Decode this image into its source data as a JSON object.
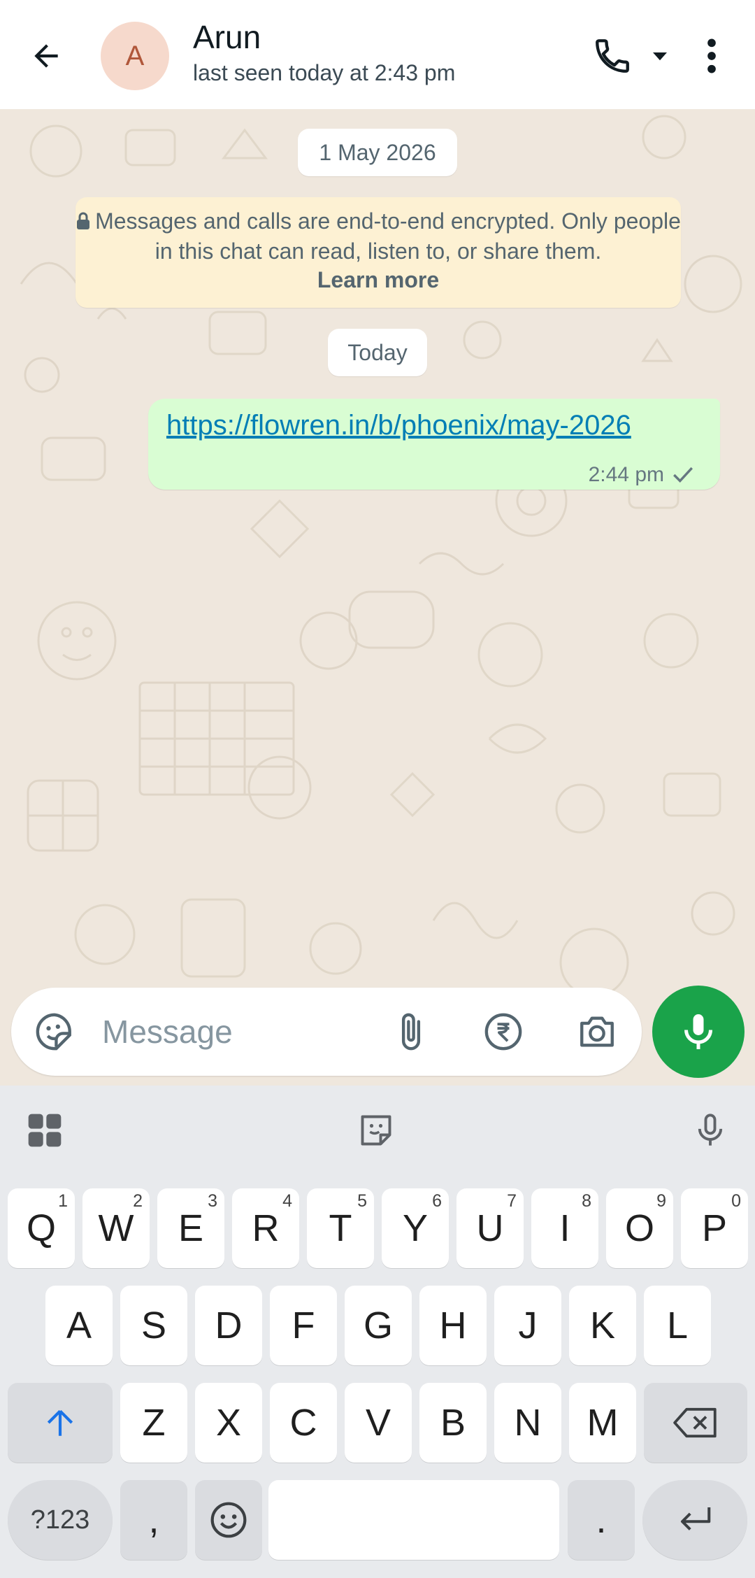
{
  "header": {
    "contact_name": "Arun",
    "avatar_initial": "A",
    "status": "last seen today at 2:43 pm"
  },
  "chat": {
    "date_chip_1": "1 May 2026",
    "encryption_notice": "Messages and calls are end-to-end encrypted. Only people in this chat can read, listen to, or share them.",
    "learn_more": "Learn more",
    "date_chip_2": "Today",
    "message": {
      "text": "https://flowren.in/b/phoenix/may-2026",
      "time": "2:44 pm",
      "status": "sent"
    }
  },
  "composer": {
    "placeholder": "Message"
  },
  "keyboard": {
    "row1": [
      {
        "label": "Q",
        "hint": "1"
      },
      {
        "label": "W",
        "hint": "2"
      },
      {
        "label": "E",
        "hint": "3"
      },
      {
        "label": "R",
        "hint": "4"
      },
      {
        "label": "T",
        "hint": "5"
      },
      {
        "label": "Y",
        "hint": "6"
      },
      {
        "label": "U",
        "hint": "7"
      },
      {
        "label": "I",
        "hint": "8"
      },
      {
        "label": "O",
        "hint": "9"
      },
      {
        "label": "P",
        "hint": "0"
      }
    ],
    "row2": [
      "A",
      "S",
      "D",
      "F",
      "G",
      "H",
      "J",
      "K",
      "L"
    ],
    "row3": [
      "Z",
      "X",
      "C",
      "V",
      "B",
      "N",
      "M"
    ],
    "symbols_label": "?123",
    "comma_label": ",",
    "period_label": "."
  },
  "colors": {
    "accent_green": "#1aa34a",
    "bubble_green": "#d9fdd3",
    "link_blue": "#027eb5",
    "chat_background": "#efe7dd"
  },
  "icons": {
    "back": "arrow-left-icon",
    "call": "phone-icon",
    "more": "more-vert-icon",
    "sticker": "sticker-icon",
    "attach": "paperclip-icon",
    "payment": "rupee-icon",
    "camera": "camera-icon",
    "mic": "mic-icon",
    "read_status": "check-icon"
  }
}
